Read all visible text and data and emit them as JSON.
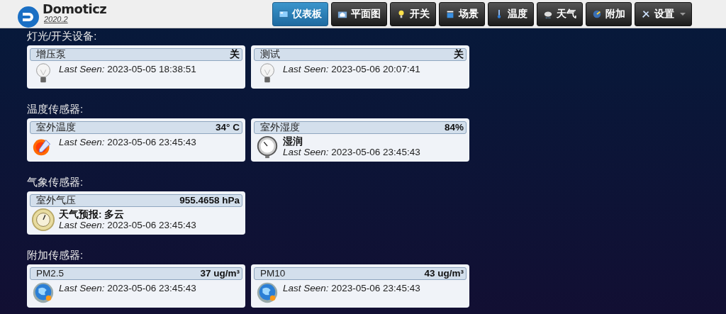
{
  "brand": {
    "name": "Domoticz",
    "version": "2020.2"
  },
  "nav": [
    {
      "label": "仪表板",
      "kind": "dashboard",
      "selected": true,
      "dropdown": false
    },
    {
      "label": "平面图",
      "kind": "floorplan",
      "selected": false,
      "dropdown": false
    },
    {
      "label": "开关",
      "kind": "bulb",
      "selected": false,
      "dropdown": false
    },
    {
      "label": "场景",
      "kind": "scene",
      "selected": false,
      "dropdown": false
    },
    {
      "label": "温度",
      "kind": "thermo",
      "selected": false,
      "dropdown": false
    },
    {
      "label": "天气",
      "kind": "weather",
      "selected": false,
      "dropdown": false
    },
    {
      "label": "附加",
      "kind": "utility",
      "selected": false,
      "dropdown": false
    },
    {
      "label": "设置",
      "kind": "tools",
      "selected": false,
      "dropdown": true
    }
  ],
  "sections": [
    {
      "title": "灯光/开关设备:",
      "devices": [
        {
          "name": "增压泵",
          "value": "关",
          "kind": "bulb",
          "last_seen": "*Last Seen:* 2023-05-05 18:38:51"
        },
        {
          "name": "测试",
          "value": "关",
          "kind": "bulb",
          "last_seen": "*Last Seen:* 2023-05-06 20:07:41"
        }
      ]
    },
    {
      "title": "温度传感器:",
      "devices": [
        {
          "name": "室外温度",
          "value": "34° C",
          "kind": "temp",
          "last_seen": "*Last Seen:* 2023-05-06 23:45:43"
        },
        {
          "name": "室外湿度",
          "value": "84%",
          "kind": "gauge",
          "status": "湿润",
          "last_seen": "*Last Seen:* 2023-05-06 23:45:43"
        }
      ]
    },
    {
      "title": "气象传感器:",
      "devices": [
        {
          "name": "室外气压",
          "value": "955.4658 hPa",
          "kind": "barometer",
          "status": "天气预报: 多云",
          "last_seen": "*Last Seen:* 2023-05-06 23:45:43"
        }
      ]
    },
    {
      "title": "附加传感器:",
      "devices": [
        {
          "name": "PM2.5",
          "value": "37 ug/m³",
          "kind": "globe",
          "last_seen": "*Last Seen:* 2023-05-06 23:45:43"
        },
        {
          "name": "PM10",
          "value": "43 ug/m³",
          "kind": "globe",
          "last_seen": "*Last Seen:* 2023-05-06 23:45:43"
        }
      ]
    }
  ]
}
